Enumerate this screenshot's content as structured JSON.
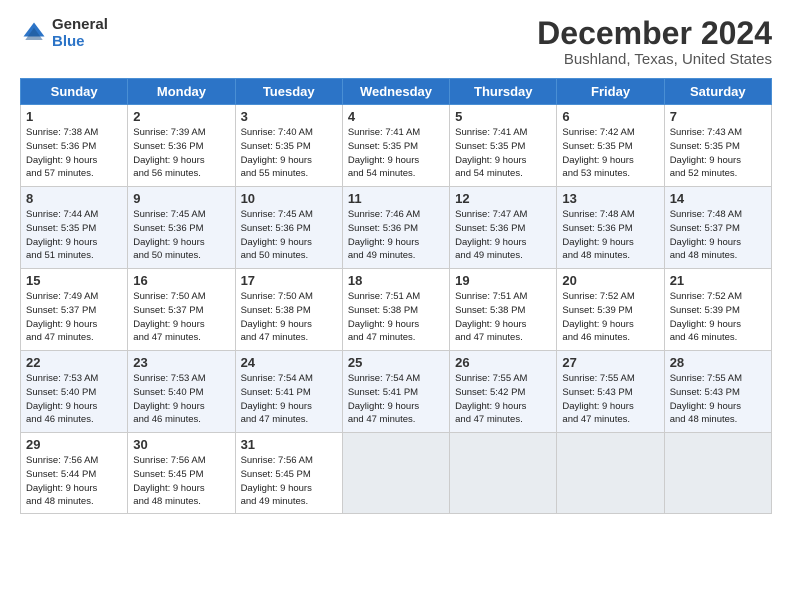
{
  "logo": {
    "line1": "General",
    "line2": "Blue"
  },
  "title": "December 2024",
  "location": "Bushland, Texas, United States",
  "days_of_week": [
    "Sunday",
    "Monday",
    "Tuesday",
    "Wednesday",
    "Thursday",
    "Friday",
    "Saturday"
  ],
  "weeks": [
    [
      {
        "day": 1,
        "info": "Sunrise: 7:38 AM\nSunset: 5:36 PM\nDaylight: 9 hours\nand 57 minutes."
      },
      {
        "day": 2,
        "info": "Sunrise: 7:39 AM\nSunset: 5:36 PM\nDaylight: 9 hours\nand 56 minutes."
      },
      {
        "day": 3,
        "info": "Sunrise: 7:40 AM\nSunset: 5:35 PM\nDaylight: 9 hours\nand 55 minutes."
      },
      {
        "day": 4,
        "info": "Sunrise: 7:41 AM\nSunset: 5:35 PM\nDaylight: 9 hours\nand 54 minutes."
      },
      {
        "day": 5,
        "info": "Sunrise: 7:41 AM\nSunset: 5:35 PM\nDaylight: 9 hours\nand 54 minutes."
      },
      {
        "day": 6,
        "info": "Sunrise: 7:42 AM\nSunset: 5:35 PM\nDaylight: 9 hours\nand 53 minutes."
      },
      {
        "day": 7,
        "info": "Sunrise: 7:43 AM\nSunset: 5:35 PM\nDaylight: 9 hours\nand 52 minutes."
      }
    ],
    [
      {
        "day": 8,
        "info": "Sunrise: 7:44 AM\nSunset: 5:35 PM\nDaylight: 9 hours\nand 51 minutes."
      },
      {
        "day": 9,
        "info": "Sunrise: 7:45 AM\nSunset: 5:36 PM\nDaylight: 9 hours\nand 50 minutes."
      },
      {
        "day": 10,
        "info": "Sunrise: 7:45 AM\nSunset: 5:36 PM\nDaylight: 9 hours\nand 50 minutes."
      },
      {
        "day": 11,
        "info": "Sunrise: 7:46 AM\nSunset: 5:36 PM\nDaylight: 9 hours\nand 49 minutes."
      },
      {
        "day": 12,
        "info": "Sunrise: 7:47 AM\nSunset: 5:36 PM\nDaylight: 9 hours\nand 49 minutes."
      },
      {
        "day": 13,
        "info": "Sunrise: 7:48 AM\nSunset: 5:36 PM\nDaylight: 9 hours\nand 48 minutes."
      },
      {
        "day": 14,
        "info": "Sunrise: 7:48 AM\nSunset: 5:37 PM\nDaylight: 9 hours\nand 48 minutes."
      }
    ],
    [
      {
        "day": 15,
        "info": "Sunrise: 7:49 AM\nSunset: 5:37 PM\nDaylight: 9 hours\nand 47 minutes."
      },
      {
        "day": 16,
        "info": "Sunrise: 7:50 AM\nSunset: 5:37 PM\nDaylight: 9 hours\nand 47 minutes."
      },
      {
        "day": 17,
        "info": "Sunrise: 7:50 AM\nSunset: 5:38 PM\nDaylight: 9 hours\nand 47 minutes."
      },
      {
        "day": 18,
        "info": "Sunrise: 7:51 AM\nSunset: 5:38 PM\nDaylight: 9 hours\nand 47 minutes."
      },
      {
        "day": 19,
        "info": "Sunrise: 7:51 AM\nSunset: 5:38 PM\nDaylight: 9 hours\nand 47 minutes."
      },
      {
        "day": 20,
        "info": "Sunrise: 7:52 AM\nSunset: 5:39 PM\nDaylight: 9 hours\nand 46 minutes."
      },
      {
        "day": 21,
        "info": "Sunrise: 7:52 AM\nSunset: 5:39 PM\nDaylight: 9 hours\nand 46 minutes."
      }
    ],
    [
      {
        "day": 22,
        "info": "Sunrise: 7:53 AM\nSunset: 5:40 PM\nDaylight: 9 hours\nand 46 minutes."
      },
      {
        "day": 23,
        "info": "Sunrise: 7:53 AM\nSunset: 5:40 PM\nDaylight: 9 hours\nand 46 minutes."
      },
      {
        "day": 24,
        "info": "Sunrise: 7:54 AM\nSunset: 5:41 PM\nDaylight: 9 hours\nand 47 minutes."
      },
      {
        "day": 25,
        "info": "Sunrise: 7:54 AM\nSunset: 5:41 PM\nDaylight: 9 hours\nand 47 minutes."
      },
      {
        "day": 26,
        "info": "Sunrise: 7:55 AM\nSunset: 5:42 PM\nDaylight: 9 hours\nand 47 minutes."
      },
      {
        "day": 27,
        "info": "Sunrise: 7:55 AM\nSunset: 5:43 PM\nDaylight: 9 hours\nand 47 minutes."
      },
      {
        "day": 28,
        "info": "Sunrise: 7:55 AM\nSunset: 5:43 PM\nDaylight: 9 hours\nand 48 minutes."
      }
    ],
    [
      {
        "day": 29,
        "info": "Sunrise: 7:56 AM\nSunset: 5:44 PM\nDaylight: 9 hours\nand 48 minutes."
      },
      {
        "day": 30,
        "info": "Sunrise: 7:56 AM\nSunset: 5:45 PM\nDaylight: 9 hours\nand 48 minutes."
      },
      {
        "day": 31,
        "info": "Sunrise: 7:56 AM\nSunset: 5:45 PM\nDaylight: 9 hours\nand 49 minutes."
      },
      null,
      null,
      null,
      null
    ]
  ]
}
